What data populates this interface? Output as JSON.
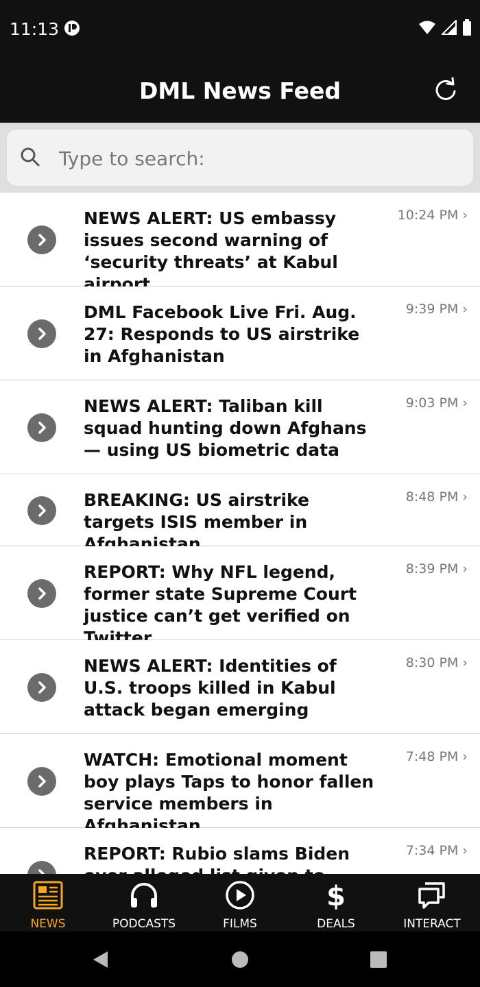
{
  "status_bar": {
    "time": "11:13",
    "app_icon": "app-notification-icon",
    "wifi_icon": "wifi-icon",
    "signal_icon": "cell-signal-icon",
    "battery_icon": "battery-icon"
  },
  "app_bar": {
    "title": "DML News Feed",
    "refresh_icon": "refresh-icon"
  },
  "search": {
    "placeholder": "Type to search:",
    "value": ""
  },
  "news": [
    {
      "headline": "NEWS ALERT: US embassy issues second warning of ‘security threats’ at Kabul airport",
      "time": "10:24 PM ›"
    },
    {
      "headline": "DML Facebook Live Fri. Aug. 27: Responds to US airstrike in Afghanistan",
      "time": "9:39 PM ›"
    },
    {
      "headline": "NEWS ALERT: Taliban kill squad hunting down Afghans — using US biometric data",
      "time": "9:03 PM ›"
    },
    {
      "headline": "BREAKING: US airstrike targets ISIS member in Afghanistan",
      "time": "8:48 PM ›"
    },
    {
      "headline": "REPORT: Why NFL legend, former state Supreme Court justice can’t get verified on Twitter",
      "time": "8:39 PM ›"
    },
    {
      "headline": "NEWS ALERT: Identities of U.S. troops killed in Kabul attack began emerging",
      "time": "8:30 PM ›"
    },
    {
      "headline": "WATCH: Emotional moment boy plays Taps to honor fallen service members in Afghanistan",
      "time": "7:48 PM ›"
    },
    {
      "headline": "REPORT: Rubio slams Biden over alleged list given to Taliban [READ",
      "time": "7:34 PM ›"
    }
  ],
  "bottom_nav": [
    {
      "label": "NEWS",
      "icon": "newspaper-icon",
      "active": true
    },
    {
      "label": "PODCASTS",
      "icon": "headphones-icon",
      "active": false
    },
    {
      "label": "FILMS",
      "icon": "play-circle-icon",
      "active": false
    },
    {
      "label": "DEALS",
      "icon": "dollar-icon",
      "active": false
    },
    {
      "label": "INTERACT",
      "icon": "chat-bubbles-icon",
      "active": false
    }
  ],
  "colors": {
    "bar": "#111111",
    "active_tab": "#f5a623",
    "chevron": "#6b6b6b",
    "time_text": "#777777"
  }
}
